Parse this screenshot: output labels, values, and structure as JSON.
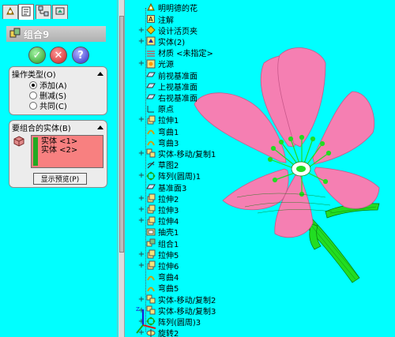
{
  "tabs": [
    {
      "name": "featuremanager-tab-icon",
      "active": false
    },
    {
      "name": "propertymanager-tab-icon",
      "active": true
    },
    {
      "name": "configurationmanager-tab-icon",
      "active": false
    },
    {
      "name": "dimxpert-tab-icon",
      "active": false
    }
  ],
  "property_manager": {
    "title": "组合9",
    "ok_icon": "✓",
    "cancel_icon": "✕",
    "help_icon": "?",
    "operation_group": {
      "title": "操作类型(O)",
      "options": [
        {
          "label": "添加(A)",
          "selected": true
        },
        {
          "label": "删减(S)",
          "selected": false
        },
        {
          "label": "共同(C)",
          "selected": false
        }
      ]
    },
    "bodies_group": {
      "title": "要组合的实体(B)",
      "bodies": [
        "实体 <1>",
        "实体 <2>"
      ],
      "preview_button": "显示预览(P)"
    }
  },
  "tree": {
    "root": "明明德的花",
    "items": [
      {
        "label": "注解",
        "icon": "annotation-icon",
        "expand": ""
      },
      {
        "label": "设计活页夹",
        "icon": "design-binder-icon",
        "expand": "+"
      },
      {
        "label": "实体(2)",
        "icon": "solid-bodies-icon",
        "expand": "+"
      },
      {
        "label": "材质 <未指定>",
        "icon": "material-icon",
        "expand": ""
      },
      {
        "label": "光源",
        "icon": "lights-icon",
        "expand": "+"
      },
      {
        "label": "前视基准面",
        "icon": "plane-icon",
        "expand": ""
      },
      {
        "label": "上视基准面",
        "icon": "plane-icon",
        "expand": ""
      },
      {
        "label": "右视基准面",
        "icon": "plane-icon",
        "expand": ""
      },
      {
        "label": "原点",
        "icon": "origin-icon",
        "expand": ""
      },
      {
        "label": "拉伸1",
        "icon": "extrude-icon",
        "expand": "+"
      },
      {
        "label": "弯曲1",
        "icon": "flex-icon",
        "expand": ""
      },
      {
        "label": "弯曲3",
        "icon": "flex-icon",
        "expand": ""
      },
      {
        "label": "实体-移动/复制1",
        "icon": "move-copy-icon",
        "expand": "+"
      },
      {
        "label": "草图2",
        "icon": "sketch-icon",
        "expand": ""
      },
      {
        "label": "阵列(圆周)1",
        "icon": "circular-pattern-icon",
        "expand": "+"
      },
      {
        "label": "基准面3",
        "icon": "plane-icon",
        "expand": ""
      },
      {
        "label": "拉伸2",
        "icon": "extrude-icon",
        "expand": "+"
      },
      {
        "label": "拉伸3",
        "icon": "extrude-icon",
        "expand": "+"
      },
      {
        "label": "拉伸4",
        "icon": "extrude-icon",
        "expand": "+"
      },
      {
        "label": "抽壳1",
        "icon": "shell-icon",
        "expand": ""
      },
      {
        "label": "组合1",
        "icon": "combine-icon",
        "expand": ""
      },
      {
        "label": "拉伸5",
        "icon": "extrude-icon",
        "expand": "+"
      },
      {
        "label": "拉伸6",
        "icon": "extrude-icon",
        "expand": "+"
      },
      {
        "label": "弯曲4",
        "icon": "flex-icon",
        "expand": ""
      },
      {
        "label": "弯曲5",
        "icon": "flex-icon",
        "expand": ""
      },
      {
        "label": "实体-移动/复制2",
        "icon": "move-copy-icon",
        "expand": "+"
      },
      {
        "label": "实体-移动/复制3",
        "icon": "move-copy-icon",
        "expand": "+"
      },
      {
        "label": "阵列(圆周)3",
        "icon": "circular-pattern-icon",
        "expand": "+"
      },
      {
        "label": "旋转2",
        "icon": "revolve-icon",
        "expand": "+"
      }
    ]
  },
  "colors": {
    "background": "#00ffff",
    "petal": "#f57fb2",
    "petal_edge": "#c8578a",
    "stem": "#22dd22",
    "bodies_list": "#f88080"
  }
}
